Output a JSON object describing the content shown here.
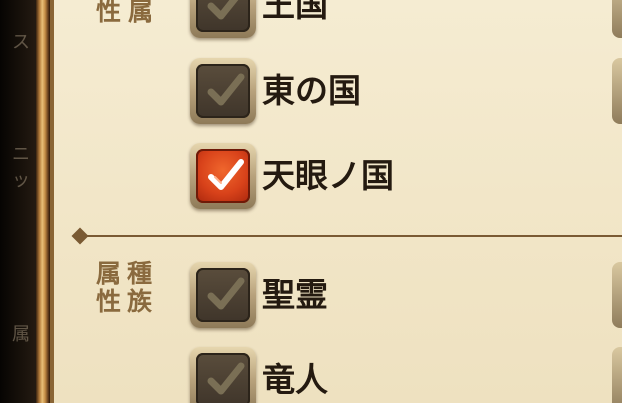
{
  "background": {
    "glyphs": [
      "ス",
      "ニッ",
      "属"
    ]
  },
  "sections": [
    {
      "label_lines": [
        "属",
        "性"
      ],
      "items": [
        {
          "label": "王国",
          "checked": false
        },
        {
          "label": "東の国",
          "checked": false
        },
        {
          "label": "天眼ノ国",
          "checked": true
        }
      ]
    },
    {
      "label_lines": [
        "属種",
        "性族"
      ],
      "items": [
        {
          "label": "聖霊",
          "checked": false
        },
        {
          "label": "竜人",
          "checked": false
        }
      ]
    }
  ],
  "colors": {
    "checked": "#d8421a",
    "unchecked": "#4a3f31",
    "checkmark_unchecked": "#7a6f55",
    "checkmark_checked": "#ffffff",
    "parchment": "#f1e5c6",
    "label_brown": "#8a6a3e"
  }
}
